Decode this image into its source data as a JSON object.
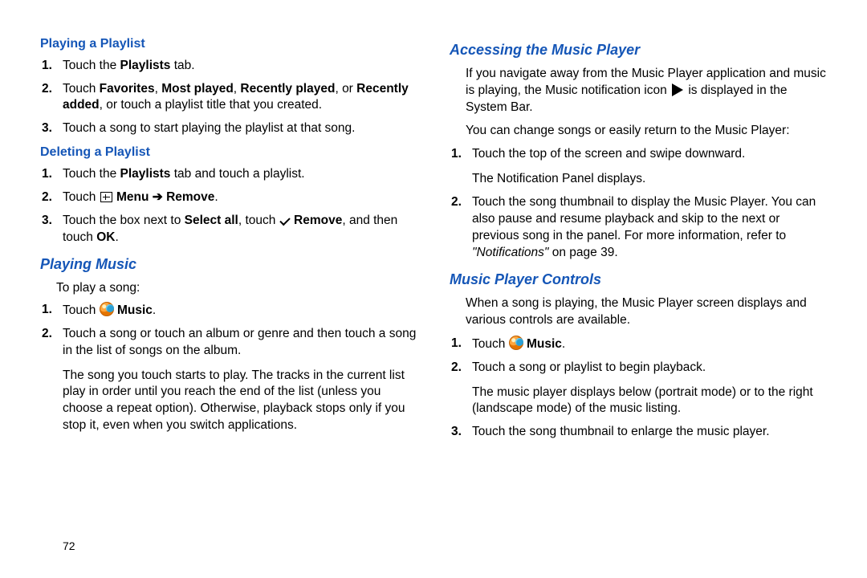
{
  "page_number": "72",
  "left": {
    "playing_playlist": {
      "heading": "Playing a Playlist",
      "s1_a": "Touch the ",
      "s1_b": "Playlists",
      "s1_c": " tab.",
      "s2_a": "Touch ",
      "s2_b": "Favorites",
      "s2_c": ", ",
      "s2_d": "Most played",
      "s2_e": ", ",
      "s2_f": "Recently played",
      "s2_g": ", or ",
      "s2_h": "Recently added",
      "s2_i": ", or touch a playlist title that you created.",
      "s3": "Touch a song to start playing the playlist at that song."
    },
    "deleting_playlist": {
      "heading": "Deleting a Playlist",
      "s1_a": "Touch the ",
      "s1_b": "Playlists",
      "s1_c": " tab and touch a playlist.",
      "s2_a": "Touch ",
      "s2_menu": " Menu",
      "s2_arrow": " ➔ ",
      "s2_remove": "Remove",
      "s2_dot": ".",
      "s3_a": "Touch the box next to ",
      "s3_b": "Select all",
      "s3_c": ", touch ",
      "s3_d": " Remove",
      "s3_e": ", and then touch ",
      "s3_f": "OK",
      "s3_g": "."
    },
    "playing_music": {
      "heading": "Playing Music",
      "intro": "To play a song:",
      "s1_a": "Touch ",
      "s1_b": " Music",
      "s1_c": ".",
      "s2": "Touch a song or touch an album or genre and then touch a song in the list of songs on the album.",
      "s2_extra": "The song you touch starts to play. The tracks in the current list play in order until you reach the end of the list (unless you choose a repeat option). Otherwise, playback stops only if you stop it, even when you switch applications."
    }
  },
  "right": {
    "accessing": {
      "heading": "Accessing the Music Player",
      "p1_a": "If you navigate away from the Music Player application and music is playing, the Music notification icon ",
      "p1_b": " is displayed in the System Bar.",
      "p2": "You can change songs or easily return to the Music Player:",
      "s1": "Touch the top of the screen and swipe downward.",
      "s1_extra": "The Notification Panel displays.",
      "s2_a": "Touch the song thumbnail to display the Music Player. You can also pause and resume playback and skip to the next or previous song in the panel. For more information, refer to ",
      "s2_b": "\"Notifications\"",
      "s2_c": " on page 39."
    },
    "controls": {
      "heading": "Music Player Controls",
      "p1": "When a song is playing, the Music Player screen displays and various controls are available.",
      "s1_a": "Touch ",
      "s1_b": " Music",
      "s1_c": ".",
      "s2": "Touch a song or playlist to begin playback.",
      "s2_extra": "The music player displays below (portrait mode) or to the right (landscape mode) of the music listing.",
      "s3": "Touch the song thumbnail to enlarge the music player."
    }
  }
}
